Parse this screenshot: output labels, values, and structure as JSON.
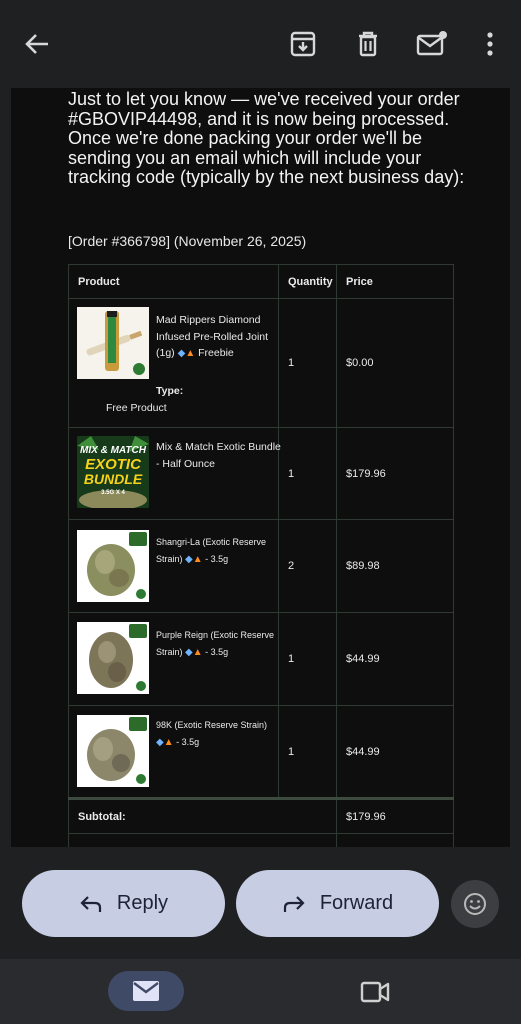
{
  "toolbar": {
    "back_icon": "arrow-left-icon",
    "archive_icon": "archive-icon",
    "delete_icon": "trash-icon",
    "mark_unread_icon": "mail-unread-icon",
    "more_icon": "more-vert-icon"
  },
  "email": {
    "intro": "Just to let you know — we've received your order #GBOVIP44498, and it is now being processed. Once we're done packing your order we'll be sending you an email which will include your tracking code (typically by the next business day):",
    "order_ref": "[Order #366798] (November 26, 2025)",
    "table": {
      "headers": [
        "Product",
        "Quantity",
        "Price"
      ],
      "rows": [
        {
          "name": "Mad Rippers Diamond Infused Pre-Rolled Joint (1g)",
          "suffix": "Freebie",
          "type_label": "Type:",
          "type_value": "Free Product",
          "quantity": "1",
          "price": "$0.00"
        },
        {
          "name": "Mix & Match Exotic Bundle - Half Ounce",
          "image_text_1": "MIX & MATCH",
          "image_text_2": "EXOTIC",
          "image_text_3": "BUNDLE",
          "image_text_4": "3.5G X 4",
          "quantity": "1",
          "price": "$179.96"
        },
        {
          "name": "Shangri-La (Exotic Reserve Strain)",
          "suffix": "- 3.5g",
          "quantity": "2",
          "price": "$89.98"
        },
        {
          "name": "Purple Reign (Exotic Reserve Strain)",
          "suffix": "- 3.5g",
          "quantity": "1",
          "price": "$44.99"
        },
        {
          "name": "98K (Exotic Reserve Strain)",
          "suffix": "- 3.5g",
          "quantity": "1",
          "price": "$44.99"
        }
      ],
      "subtotal_label": "Subtotal:",
      "subtotal_value": "$179.96"
    }
  },
  "actions": {
    "reply_label": "Reply",
    "forward_label": "Forward",
    "emoji_icon": "smiley-icon"
  },
  "nav": {
    "mail_icon": "mail-icon",
    "video_icon": "video-camera-icon"
  },
  "colors": {
    "background": "#1f2022",
    "email_body": "#0e0e0f",
    "pill": "#c7cde3",
    "nav_active": "#3f4a66"
  }
}
